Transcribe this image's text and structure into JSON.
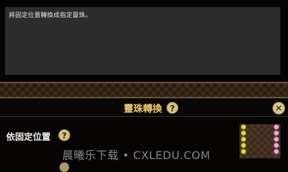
{
  "description": {
    "text": "將固定位置轉換成指定靈珠。"
  },
  "header": {
    "title": "靈珠轉換",
    "help_label": "?",
    "close_label": "✕"
  },
  "option": {
    "label": "依固定位置",
    "help_label": "?"
  },
  "watermark": "晨曦乐下载 • CXLEDU.COM",
  "preview_colors": {
    "left": "#e6dc30",
    "right": "#f3a7d9"
  }
}
